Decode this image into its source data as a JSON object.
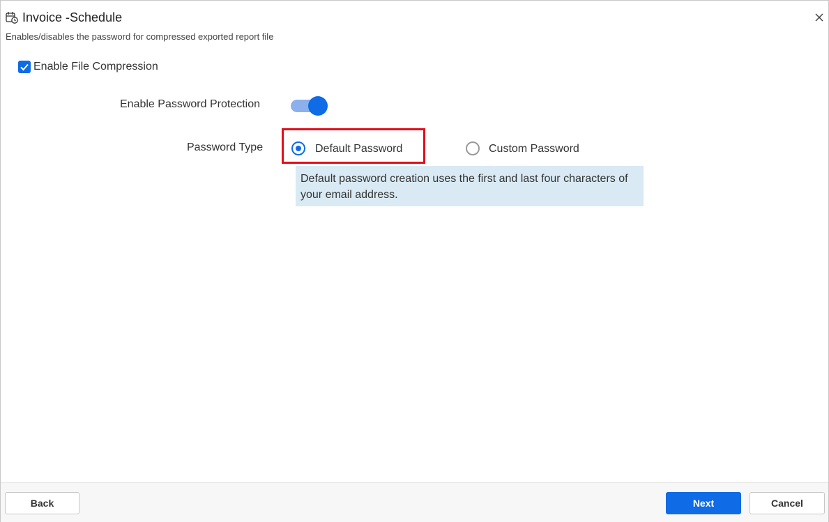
{
  "header": {
    "title": "Invoice -Schedule",
    "subtitle": "Enables/disables the password for compressed exported report file",
    "icon": "calendar-clock-icon"
  },
  "compression": {
    "label": "Enable File Compression",
    "checked": true
  },
  "password_protection": {
    "label": "Enable Password Protection",
    "enabled": true
  },
  "password_type": {
    "label": "Password Type",
    "options": [
      {
        "label": "Default Password",
        "selected": true
      },
      {
        "label": "Custom Password",
        "selected": false
      }
    ],
    "info": "Default password creation uses the first and last four characters of your email address."
  },
  "footer": {
    "back_label": "Back",
    "next_label": "Next",
    "cancel_label": "Cancel"
  },
  "colors": {
    "accent": "#0f6be6",
    "highlight": "#e10f19",
    "info_bg": "#d9eaf4"
  }
}
